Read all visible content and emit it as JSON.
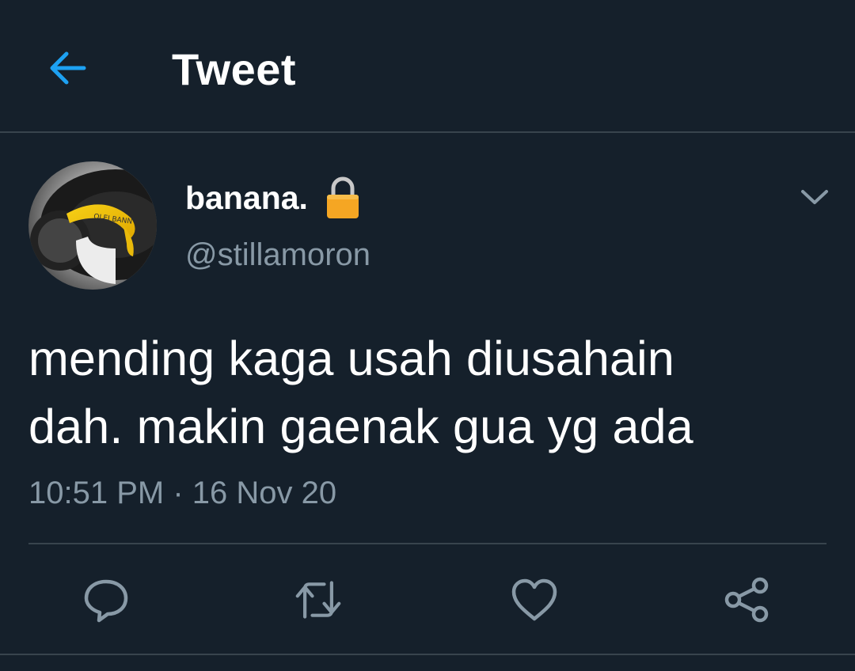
{
  "header": {
    "title": "Tweet",
    "back_icon": "arrow-left-icon"
  },
  "tweet": {
    "display_name": "banana.",
    "protected_icon": "lock-icon",
    "handle": "@stillamoron",
    "text_line1": "mending kaga usah diusahain",
    "text_line2": "dah. makin gaenak gua yg ada",
    "timestamp": "10:51 PM · 16 Nov 20",
    "menu_icon": "chevron-down-icon"
  },
  "actions": {
    "reply_icon": "reply-icon",
    "retweet_icon": "retweet-icon",
    "like_icon": "heart-icon",
    "share_icon": "share-icon"
  },
  "colors": {
    "background": "#15202b",
    "accent": "#1da1f2",
    "secondary_text": "#8899a6",
    "border": "#38444d",
    "lock": "#f5a623"
  }
}
